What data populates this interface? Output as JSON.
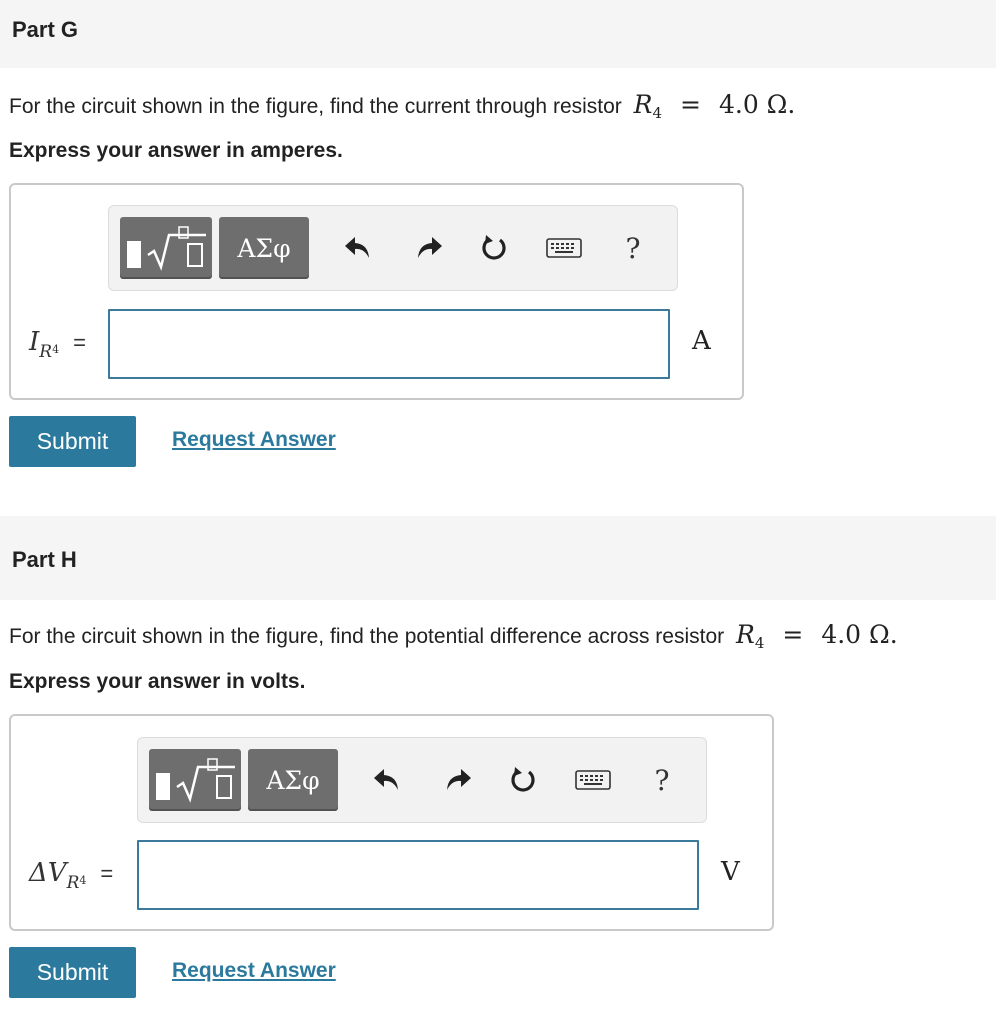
{
  "parts": [
    {
      "title": "Part G",
      "question_text": "For the circuit shown in the figure, find the current through resistor",
      "resistor_symbol": "R",
      "resistor_index": "4",
      "equals": "=",
      "resistor_value": "4.0 Ω.",
      "instruction": "Express your answer in amperes.",
      "variable_main": "I",
      "variable_sub": "R",
      "variable_subsub": "4",
      "variable_equals": "=",
      "input_value": "",
      "unit": "A",
      "toolbar": {
        "greek_label": "ΑΣφ",
        "help_label": "?"
      },
      "submit_label": "Submit",
      "request_answer_label": "Request Answer"
    },
    {
      "title": "Part H",
      "question_text": "For the circuit shown in the figure, find the potential difference across resistor",
      "resistor_symbol": "R",
      "resistor_index": "4",
      "equals": "=",
      "resistor_value": "4.0 Ω.",
      "instruction": "Express your answer in volts.",
      "variable_main": "ΔV",
      "variable_sub": "R",
      "variable_subsub": "4",
      "variable_equals": "=",
      "input_value": "",
      "unit": "V",
      "toolbar": {
        "greek_label": "ΑΣφ",
        "help_label": "?"
      },
      "submit_label": "Submit",
      "request_answer_label": "Request Answer"
    }
  ],
  "colors": {
    "accent": "#2b7a9e",
    "header_bg": "#f5f5f5",
    "toolbar_button": "#6e6e6e",
    "input_border": "#3c7a9c"
  }
}
